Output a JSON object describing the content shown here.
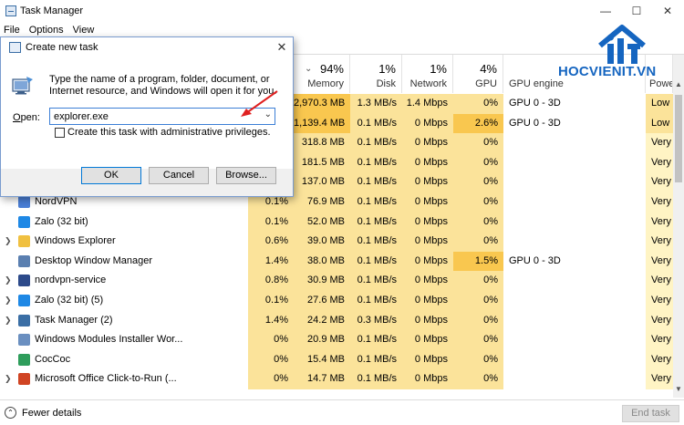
{
  "window": {
    "title": "Task Manager"
  },
  "menubar": [
    "File",
    "Options",
    "View"
  ],
  "columns": {
    "memory": {
      "pct": "94%",
      "label": "Memory"
    },
    "disk": {
      "pct": "1%",
      "label": "Disk"
    },
    "network": {
      "pct": "1%",
      "label": "Network"
    },
    "gpu": {
      "pct": "4%",
      "label": "GPU"
    },
    "gpu_engine": {
      "label": "GPU engine"
    },
    "power_usage": {
      "label": "Power us"
    }
  },
  "rows": [
    {
      "name": "",
      "expandable": false,
      "icon_color": "",
      "cpu": "",
      "memory": "2,970.3 MB",
      "disk": "1.3 MB/s",
      "network": "1.4 Mbps",
      "gpu": "0%",
      "gpu_engine": "GPU 0 - 3D",
      "power": "Low"
    },
    {
      "name": "",
      "expandable": false,
      "icon_color": "",
      "cpu": "",
      "memory": "1,139.4 MB",
      "disk": "0.1 MB/s",
      "network": "0 Mbps",
      "gpu": "2.6%",
      "gpu_engine": "GPU 0 - 3D",
      "power": "Low"
    },
    {
      "name": "",
      "expandable": false,
      "icon_color": "",
      "cpu": "",
      "memory": "318.8 MB",
      "disk": "0.1 MB/s",
      "network": "0 Mbps",
      "gpu": "0%",
      "gpu_engine": "",
      "power": "Very lo"
    },
    {
      "name": "",
      "expandable": false,
      "icon_color": "",
      "cpu": "",
      "memory": "181.5 MB",
      "disk": "0.1 MB/s",
      "network": "0 Mbps",
      "gpu": "0%",
      "gpu_engine": "",
      "power": "Very lo"
    },
    {
      "name": "",
      "expandable": false,
      "icon_color": "",
      "cpu": "",
      "memory": "137.0 MB",
      "disk": "0.1 MB/s",
      "network": "0 Mbps",
      "gpu": "0%",
      "gpu_engine": "",
      "power": "Very lo"
    },
    {
      "name": "NordVPN",
      "expandable": false,
      "icon_color": "#4a7fd6",
      "cpu": "0.1%",
      "memory": "76.9 MB",
      "disk": "0.1 MB/s",
      "network": "0 Mbps",
      "gpu": "0%",
      "gpu_engine": "",
      "power": "Very lo"
    },
    {
      "name": "Zalo (32 bit)",
      "expandable": false,
      "icon_color": "#1e88e5",
      "cpu": "0.1%",
      "memory": "52.0 MB",
      "disk": "0.1 MB/s",
      "network": "0 Mbps",
      "gpu": "0%",
      "gpu_engine": "",
      "power": "Very lo"
    },
    {
      "name": "Windows Explorer",
      "expandable": true,
      "icon_color": "#f0c040",
      "cpu": "0.6%",
      "memory": "39.0 MB",
      "disk": "0.1 MB/s",
      "network": "0 Mbps",
      "gpu": "0%",
      "gpu_engine": "",
      "power": "Very lo"
    },
    {
      "name": "Desktop Window Manager",
      "expandable": false,
      "icon_color": "#5a7fb0",
      "cpu": "1.4%",
      "memory": "38.0 MB",
      "disk": "0.1 MB/s",
      "network": "0 Mbps",
      "gpu": "1.5%",
      "gpu_engine": "GPU 0 - 3D",
      "power": "Very lo"
    },
    {
      "name": "nordvpn-service",
      "expandable": true,
      "icon_color": "#2c4a8a",
      "cpu": "0.8%",
      "memory": "30.9 MB",
      "disk": "0.1 MB/s",
      "network": "0 Mbps",
      "gpu": "0%",
      "gpu_engine": "",
      "power": "Very lo"
    },
    {
      "name": "Zalo (32 bit) (5)",
      "expandable": true,
      "icon_color": "#1e88e5",
      "cpu": "0.1%",
      "memory": "27.6 MB",
      "disk": "0.1 MB/s",
      "network": "0 Mbps",
      "gpu": "0%",
      "gpu_engine": "",
      "power": "Very lo"
    },
    {
      "name": "Task Manager (2)",
      "expandable": true,
      "icon_color": "#3a6ea5",
      "cpu": "1.4%",
      "memory": "24.2 MB",
      "disk": "0.3 MB/s",
      "network": "0 Mbps",
      "gpu": "0%",
      "gpu_engine": "",
      "power": "Very lo"
    },
    {
      "name": "Windows Modules Installer Wor...",
      "expandable": false,
      "icon_color": "#6a8fc0",
      "cpu": "0%",
      "memory": "20.9 MB",
      "disk": "0.1 MB/s",
      "network": "0 Mbps",
      "gpu": "0%",
      "gpu_engine": "",
      "power": "Very lo"
    },
    {
      "name": "CocCoc",
      "expandable": false,
      "icon_color": "#2e9d5b",
      "cpu": "0%",
      "memory": "15.4 MB",
      "disk": "0.1 MB/s",
      "network": "0 Mbps",
      "gpu": "0%",
      "gpu_engine": "",
      "power": "Very lo"
    },
    {
      "name": "Microsoft Office Click-to-Run (...",
      "expandable": true,
      "icon_color": "#d04423",
      "cpu": "0%",
      "memory": "14.7 MB",
      "disk": "0.1 MB/s",
      "network": "0 Mbps",
      "gpu": "0%",
      "gpu_engine": "",
      "power": "Very lo"
    }
  ],
  "footer": {
    "fewer_details": "Fewer details",
    "end_task": "End task"
  },
  "dialog": {
    "title": "Create new task",
    "description": "Type the name of a program, folder, document, or Internet resource, and Windows will open it for you.",
    "open_label": "Open:",
    "open_value": "explorer.exe",
    "admin_label": "Create this task with administrative privileges.",
    "ok": "OK",
    "cancel": "Cancel",
    "browse": "Browse..."
  },
  "logo": {
    "text": "HOCVIENIT.VN"
  },
  "colors": {
    "heat_high": "#f9c74f",
    "heat_mid": "#fbe39a",
    "heat_low": "#fff4c4",
    "accent": "#0078d7",
    "logo_blue": "#1565c0",
    "arrow_red": "#e02020"
  },
  "icons": [
    "app-icon",
    "run-icon",
    "close-icon",
    "chevron-down-icon",
    "fewer-details-icon",
    "red-arrow-icon"
  ]
}
